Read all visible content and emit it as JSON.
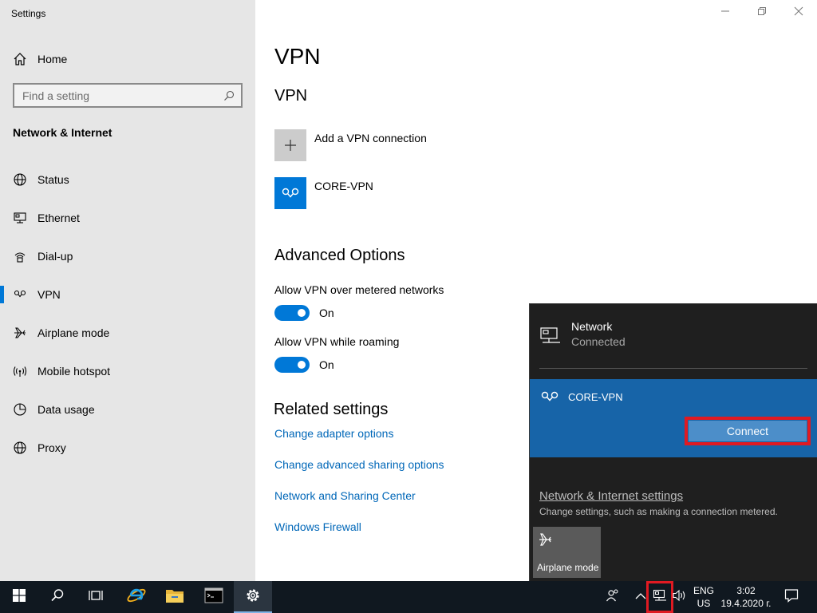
{
  "window": {
    "app_title": "Settings",
    "minimize_icon": "minimize-icon",
    "maximize_icon": "restore-icon",
    "close_icon": "close-icon"
  },
  "sidebar": {
    "home_label": "Home",
    "search_placeholder": "Find a setting",
    "section_title": "Network & Internet",
    "items": [
      {
        "label": "Status",
        "icon": "globe-icon"
      },
      {
        "label": "Ethernet",
        "icon": "ethernet-icon"
      },
      {
        "label": "Dial-up",
        "icon": "dialup-icon"
      },
      {
        "label": "VPN",
        "icon": "vpn-icon",
        "active": true
      },
      {
        "label": "Airplane mode",
        "icon": "airplane-icon"
      },
      {
        "label": "Mobile hotspot",
        "icon": "hotspot-icon"
      },
      {
        "label": "Data usage",
        "icon": "data-usage-icon"
      },
      {
        "label": "Proxy",
        "icon": "globe-icon"
      }
    ]
  },
  "main": {
    "title": "VPN",
    "section_title": "VPN",
    "add_vpn_label": "Add a VPN connection",
    "vpn_connection_name": "CORE-VPN",
    "advanced_title": "Advanced Options",
    "metered_label": "Allow VPN over metered networks",
    "metered_state": "On",
    "roaming_label": "Allow VPN while roaming",
    "roaming_state": "On",
    "related_title": "Related settings",
    "links": [
      "Change adapter options",
      "Change advanced sharing options",
      "Network and Sharing Center",
      "Windows Firewall"
    ],
    "accent_color": "#0078d7"
  },
  "flyout": {
    "network_name": "Network",
    "network_status": "Connected",
    "vpn_name": "CORE-VPN",
    "connect_label": "Connect",
    "settings_link": "Network & Internet settings",
    "settings_desc": "Change settings, such as making a connection metered.",
    "airplane_label": "Airplane mode",
    "panel_color": "#1764a8",
    "highlight_color": "#e01a22"
  },
  "taskbar": {
    "lang_line1": "ENG",
    "lang_line2": "US",
    "time": "3:02",
    "date": "19.4.2020 г."
  }
}
